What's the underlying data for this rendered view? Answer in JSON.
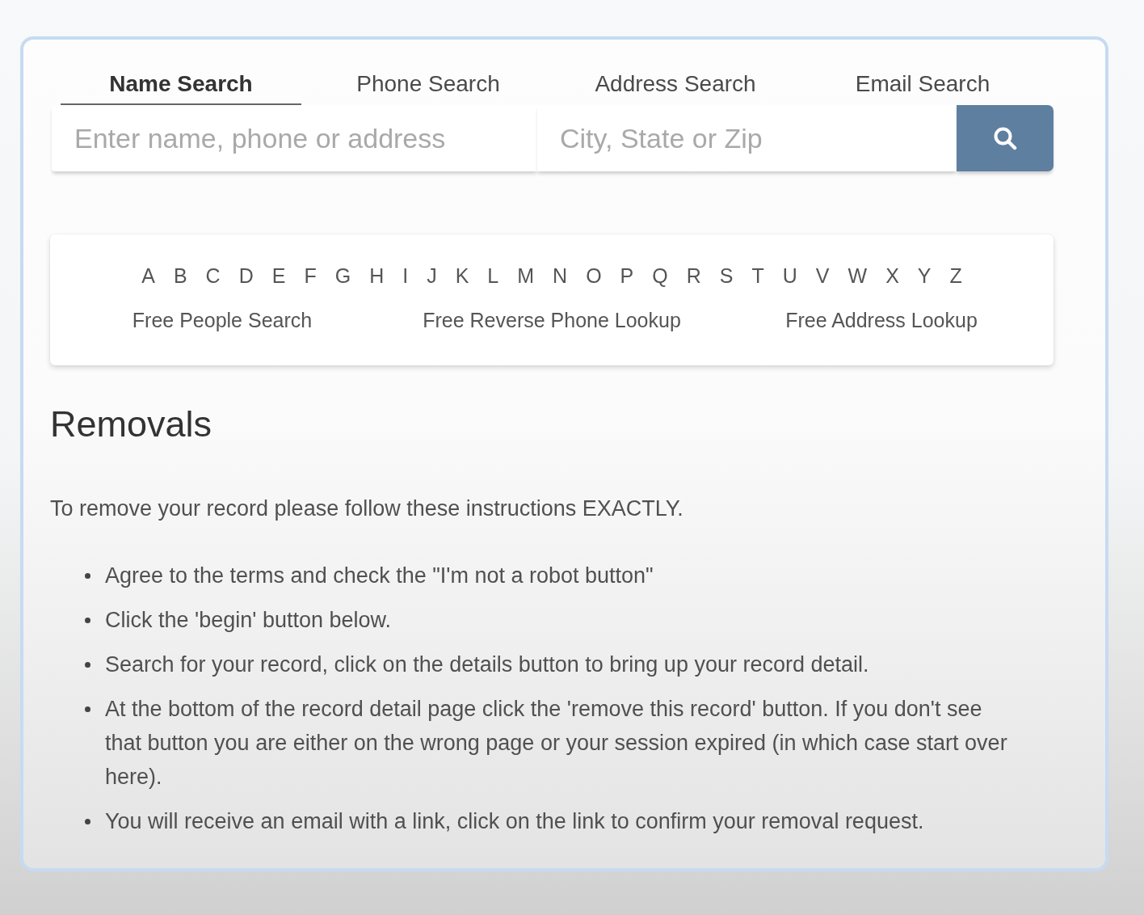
{
  "tabs": [
    {
      "label": "Name Search",
      "selected": true
    },
    {
      "label": "Phone Search",
      "selected": false
    },
    {
      "label": "Address Search",
      "selected": false
    },
    {
      "label": "Email Search",
      "selected": false
    }
  ],
  "search": {
    "fields": [
      {
        "placeholder": "Enter name, phone or address"
      },
      {
        "placeholder": "City, State or Zip"
      }
    ]
  },
  "alphabet": [
    "A",
    "B",
    "C",
    "D",
    "E",
    "F",
    "G",
    "H",
    "I",
    "J",
    "K",
    "L",
    "M",
    "N",
    "O",
    "P",
    "Q",
    "R",
    "S",
    "T",
    "U",
    "V",
    "W",
    "X",
    "Y",
    "Z"
  ],
  "links": [
    "Free People Search",
    "Free Reverse Phone Lookup",
    "Free Address Lookup"
  ],
  "removals": {
    "heading": "Removals",
    "intro": "To remove your record please follow these instructions EXACTLY.",
    "steps": [
      "Agree to the terms and check the \"I'm not a robot button\"",
      "Click the 'begin' button below.",
      "Search for your record, click on the details button to bring up your record detail.",
      "At the bottom of the record detail page click the 'remove this record' button. If you don't see that button you are either on the wrong page or your session expired (in which case start over here).",
      "You will receive an email with a link, click on the link to confirm your removal request."
    ]
  }
}
